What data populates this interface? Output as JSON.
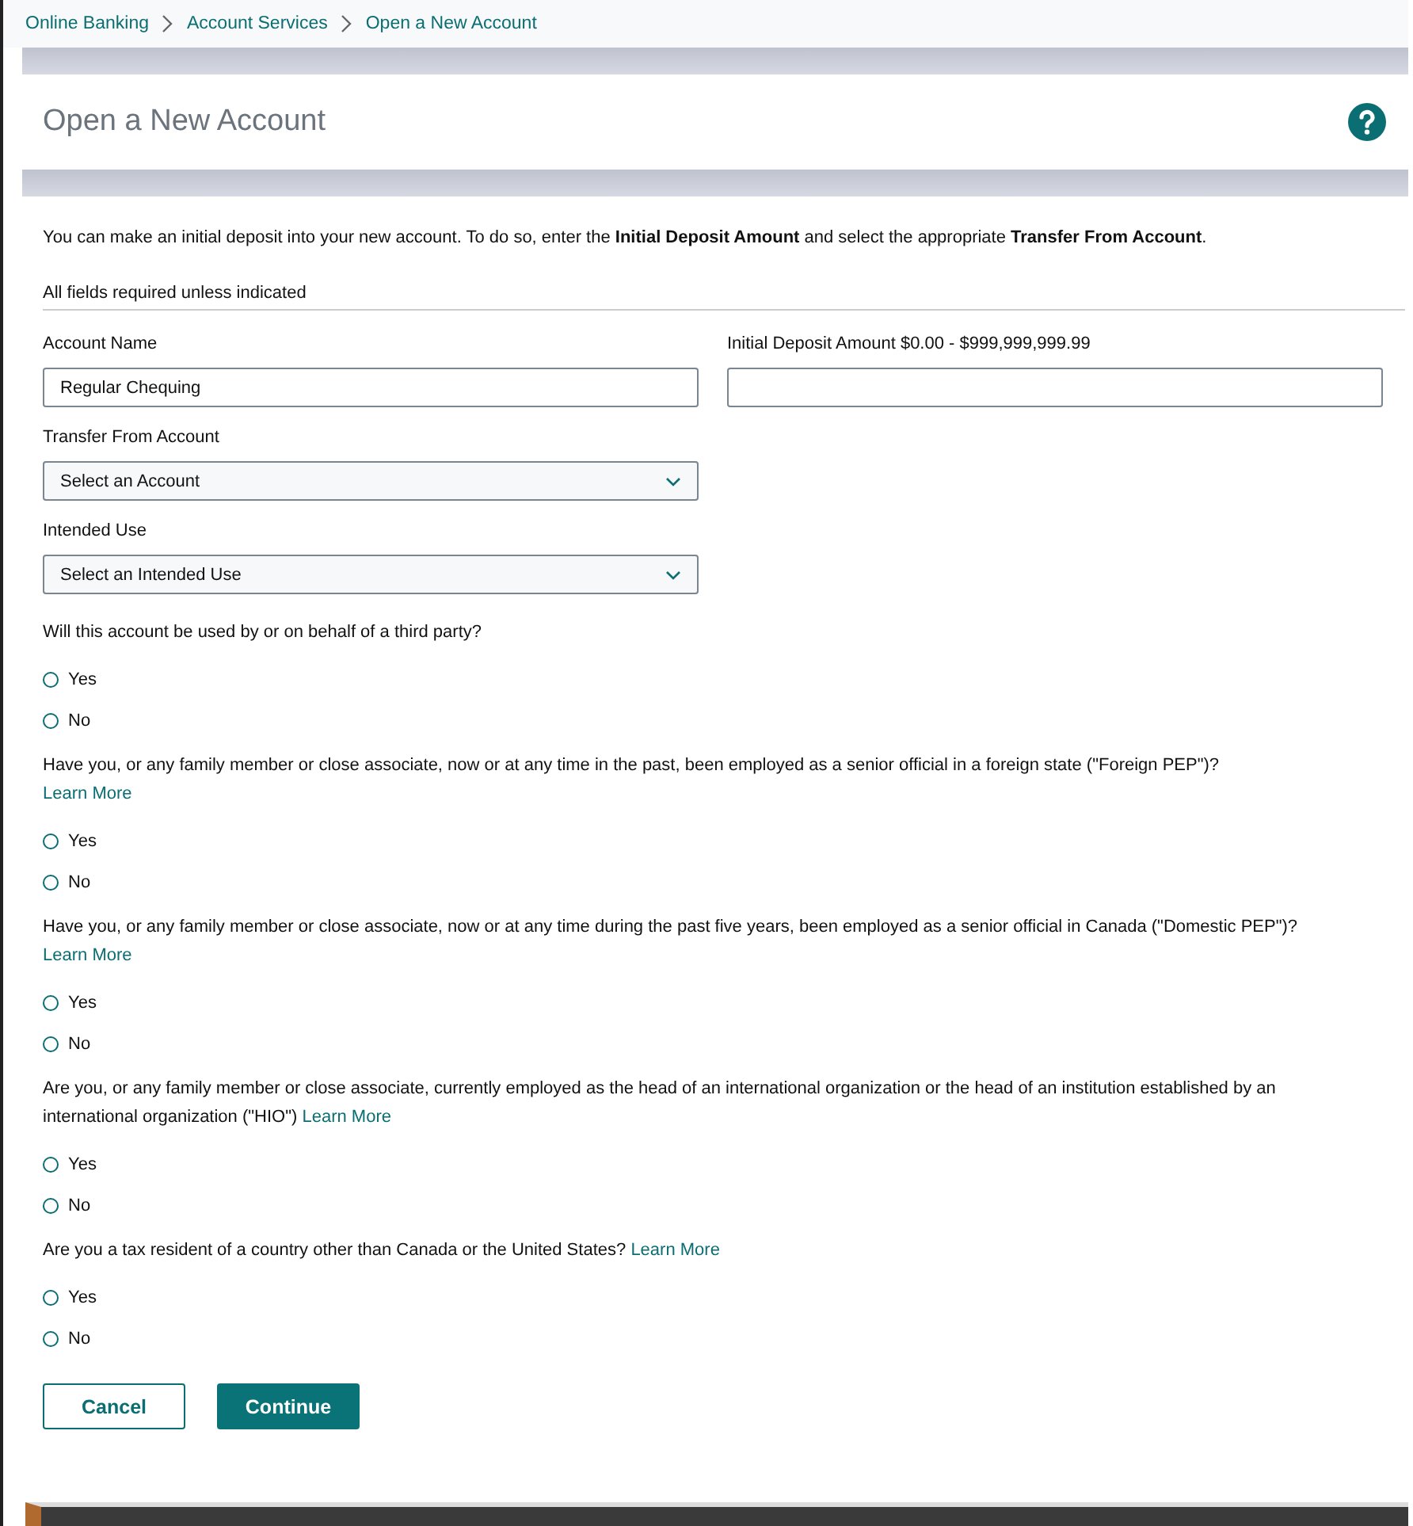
{
  "breadcrumbs": [
    "Online Banking",
    "Account Services",
    "Open a New Account"
  ],
  "title": "Open a New Account",
  "intro": "You can make an initial deposit into your new account. To do so, enter the **Initial Deposit Amount** and select the appropriate **Transfer From Account**.",
  "required_note": "All fields required unless indicated",
  "fields": [
    {
      "kind": "text",
      "label": "Account Name",
      "value": "Regular Chequing"
    },
    {
      "kind": "text",
      "label": "Initial Deposit Amount $0.00 - $999,999,999.99"
    },
    {
      "kind": "select",
      "label": "Transfer From Account",
      "value": "Select an Account"
    },
    {
      "kind": "select",
      "label": "Intended Use",
      "value": "Select an Intended Use"
    }
  ],
  "questions": [
    {
      "text": "Will this account be used by or on behalf of a third party?",
      "options": [
        {
          "label": "Yes",
          "selected": false
        },
        {
          "label": "No",
          "selected": false
        }
      ]
    },
    {
      "text": "Have you, or any family member or close associate, now or at any time in the past, been employed as a senior official in a foreign state (\"Foreign PEP\")?",
      "link": "Learn More",
      "options": [
        {
          "label": "Yes",
          "selected": false
        },
        {
          "label": "No",
          "selected": false
        }
      ]
    },
    {
      "text": "Have you, or any family member or close associate, now or at any time during the past five years, been employed as a senior official in Canada (\"Domestic PEP\")?",
      "link": "Learn More",
      "options": [
        {
          "label": "Yes",
          "selected": false
        },
        {
          "label": "No",
          "selected": false
        }
      ]
    },
    {
      "text": "Are you, or any family member or close associate, currently employed as the head of an international organization or the head of an institution established by an international organization (\"HIO\")",
      "link": "Learn More",
      "options": [
        {
          "label": "Yes",
          "selected": false
        },
        {
          "label": "No",
          "selected": false
        }
      ]
    },
    {
      "text": "Are you a tax resident of a country other than Canada or the United States?",
      "link": "Learn More",
      "options": [
        {
          "label": "Yes",
          "selected": false
        },
        {
          "label": "No",
          "selected": false
        }
      ]
    }
  ],
  "buttons": [
    {
      "kind": "secondary",
      "label": "Cancel"
    },
    {
      "kind": "primary",
      "label": "Continue"
    }
  ]
}
